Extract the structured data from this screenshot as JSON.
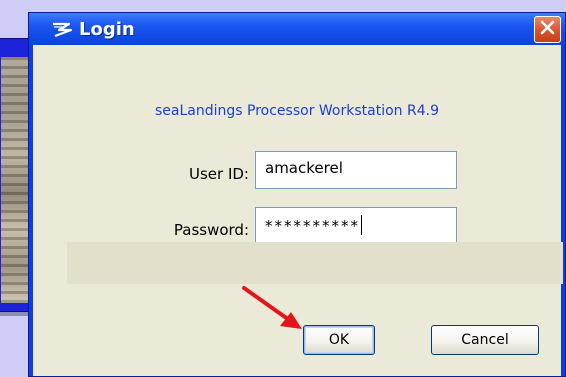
{
  "dialog": {
    "title": "Login",
    "close_icon": "close-icon",
    "app_icon": "sealandings-logo-icon"
  },
  "form": {
    "heading": "seaLandings Processor Workstation R4.9",
    "user_id_label": "User ID:",
    "user_id_value": "amackerel",
    "password_label": "Password:",
    "password_value": "**********"
  },
  "buttons": {
    "ok_label": "OK",
    "cancel_label": "Cancel"
  },
  "annotation": {
    "arrow_color": "#e3151a"
  },
  "colors": {
    "titlebar": "#0b43dd",
    "heading_text": "#1a3fd1",
    "dialog_bg": "#ebe9d8",
    "close_button": "#d9532c"
  }
}
